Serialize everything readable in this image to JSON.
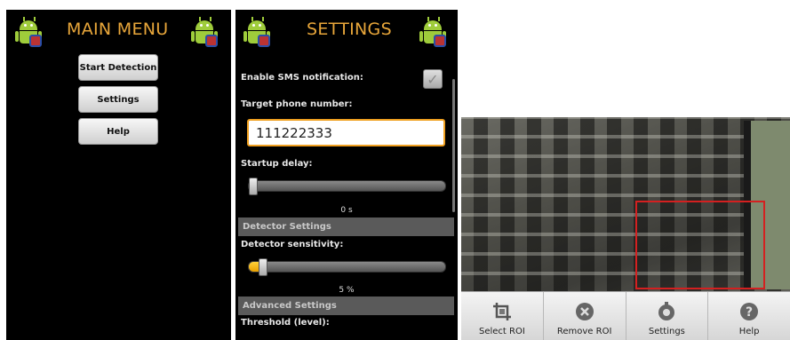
{
  "main_menu": {
    "title": "MAIN MENU",
    "buttons": [
      "Start Detection",
      "Settings",
      "Help"
    ]
  },
  "settings": {
    "title": "SETTINGS",
    "enable_sms_label": "Enable SMS notification:",
    "enable_sms_checked": true,
    "target_phone_label": "Target phone number:",
    "target_phone_value": "111222333",
    "startup_delay_label": "Startup delay:",
    "startup_delay_value": "0 s",
    "startup_delay_fraction": 0.0,
    "detector_section": "Detector Settings",
    "sensitivity_label": "Detector sensitivity:",
    "sensitivity_value": "5 %",
    "sensitivity_fraction": 0.05,
    "advanced_section": "Advanced Settings",
    "threshold_label": "Threshold (level):"
  },
  "camera": {
    "action_bar": [
      {
        "label": "Select ROI",
        "icon": "crop-icon"
      },
      {
        "label": "Remove ROI",
        "icon": "remove-icon"
      },
      {
        "label": "Settings",
        "icon": "settings-icon"
      },
      {
        "label": "Help",
        "icon": "help-icon"
      }
    ],
    "roi_color": "#d42020"
  },
  "colors": {
    "title_accent": "#e8a63a",
    "input_focus": "#f0a020",
    "android_green": "#9fcc3b"
  }
}
